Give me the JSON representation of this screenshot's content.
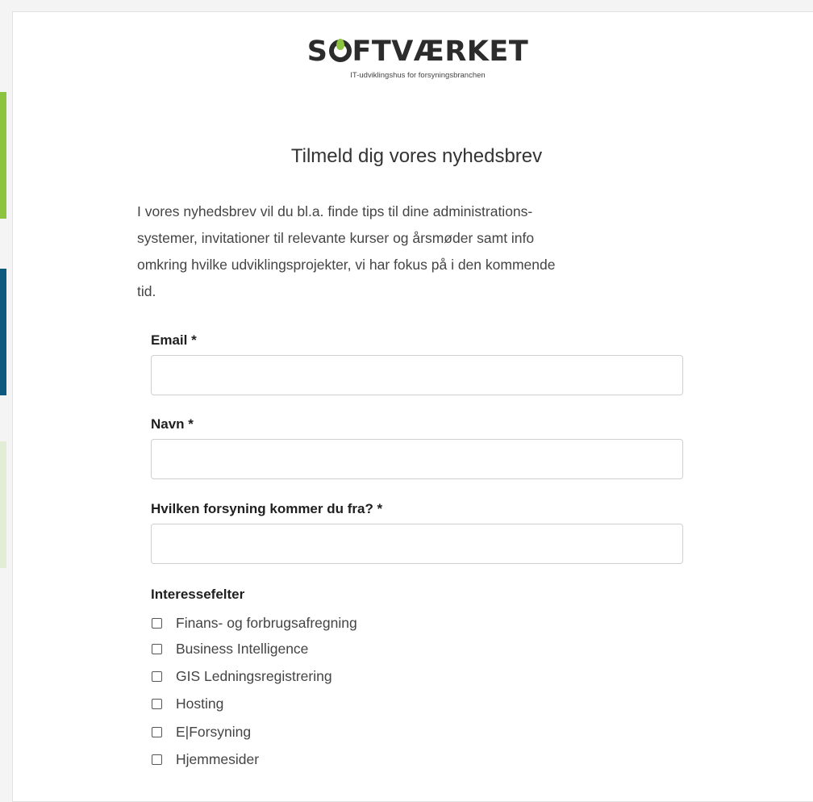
{
  "brand": {
    "logo_text_before": "S",
    "logo_text_after": "FTVÆRKET",
    "tagline": "IT-udviklingshus for forsyningsbranchen",
    "accent_color": "#8cc43f",
    "secondary_color": "#0d5a7e"
  },
  "form": {
    "title": "Tilmeld dig vores nyhedsbrev",
    "intro": "I vores nyhedsbrev vil du bl.a. finde tips til dine administrations-systemer, invitationer til relevante kurser og årsmøder samt info omkring hvilke udviklingsprojekter, vi har fokus på i den kommende tid.",
    "intro_lines": [
      "I vores nyhedsbrev vil du bl.a. finde tips til dine administrations-",
      "systemer, invitationer til relevante kurser og årsmøder samt info",
      "omkring hvilke udviklingsprojekter, vi har fokus på i den kommende",
      "tid."
    ],
    "email_label": "Email *",
    "email_value": "",
    "name_label": "Navn *",
    "name_value": "",
    "utility_label": "Hvilken forsyning kommer du fra? *",
    "utility_value": "",
    "interests_label": "Interessefelter",
    "interests": [
      {
        "label": "Finans- og forbrugsafregning",
        "checked": false
      },
      {
        "label": "Business Intelligence",
        "checked": false
      },
      {
        "label": "GIS Ledningsregistrering",
        "checked": false
      },
      {
        "label": "Hosting",
        "checked": false
      },
      {
        "label": "E|Forsyning",
        "checked": false
      },
      {
        "label": "Hjemmesider",
        "checked": false
      }
    ]
  }
}
